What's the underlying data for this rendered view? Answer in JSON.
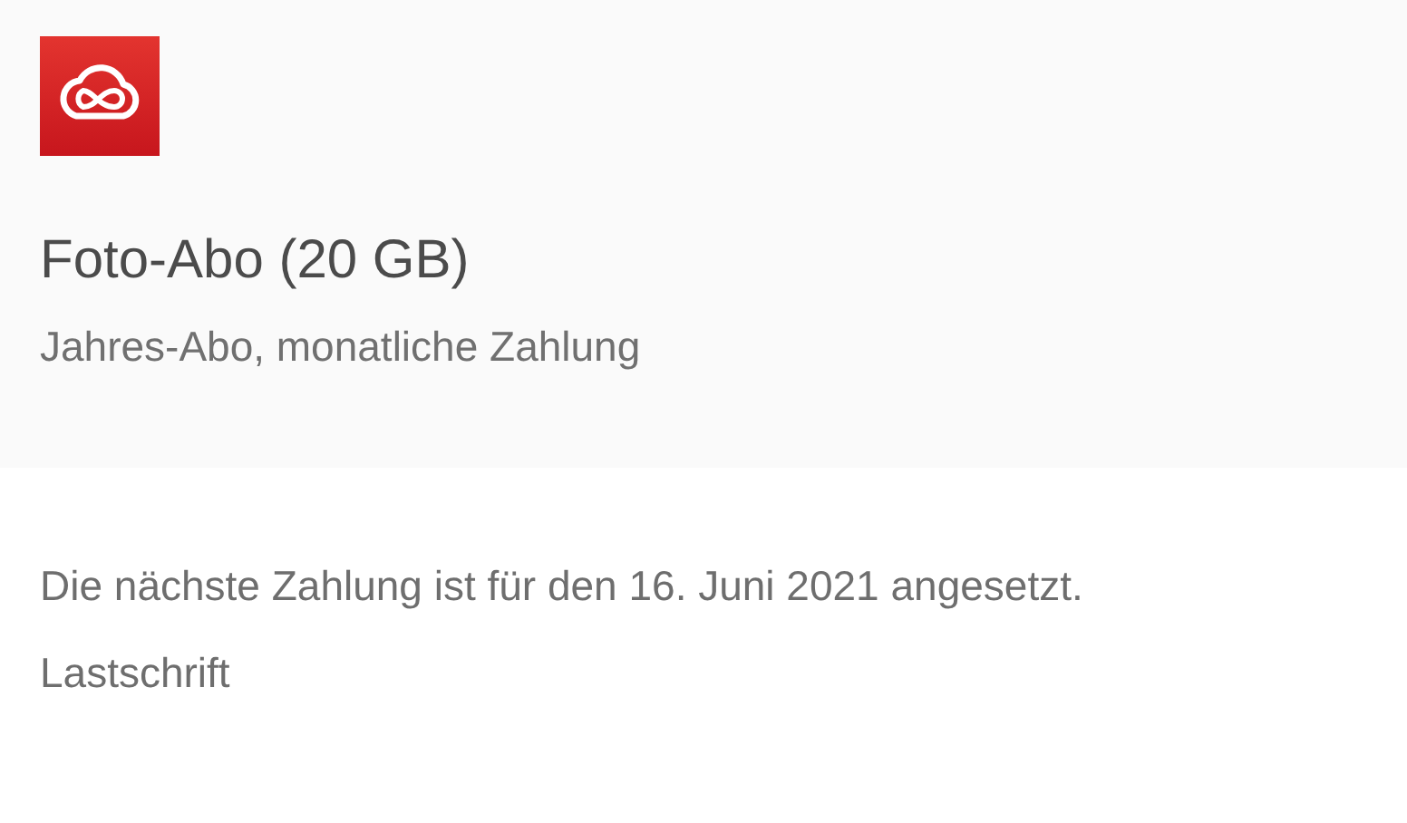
{
  "plan": {
    "title": "Foto-Abo (20 GB)",
    "subtitle": "Jahres-Abo, monatliche Zahlung"
  },
  "details": [
    "Die nächste Zahlung ist für den 16. Juni 2021 angesetzt.",
    "Lastschrift"
  ]
}
